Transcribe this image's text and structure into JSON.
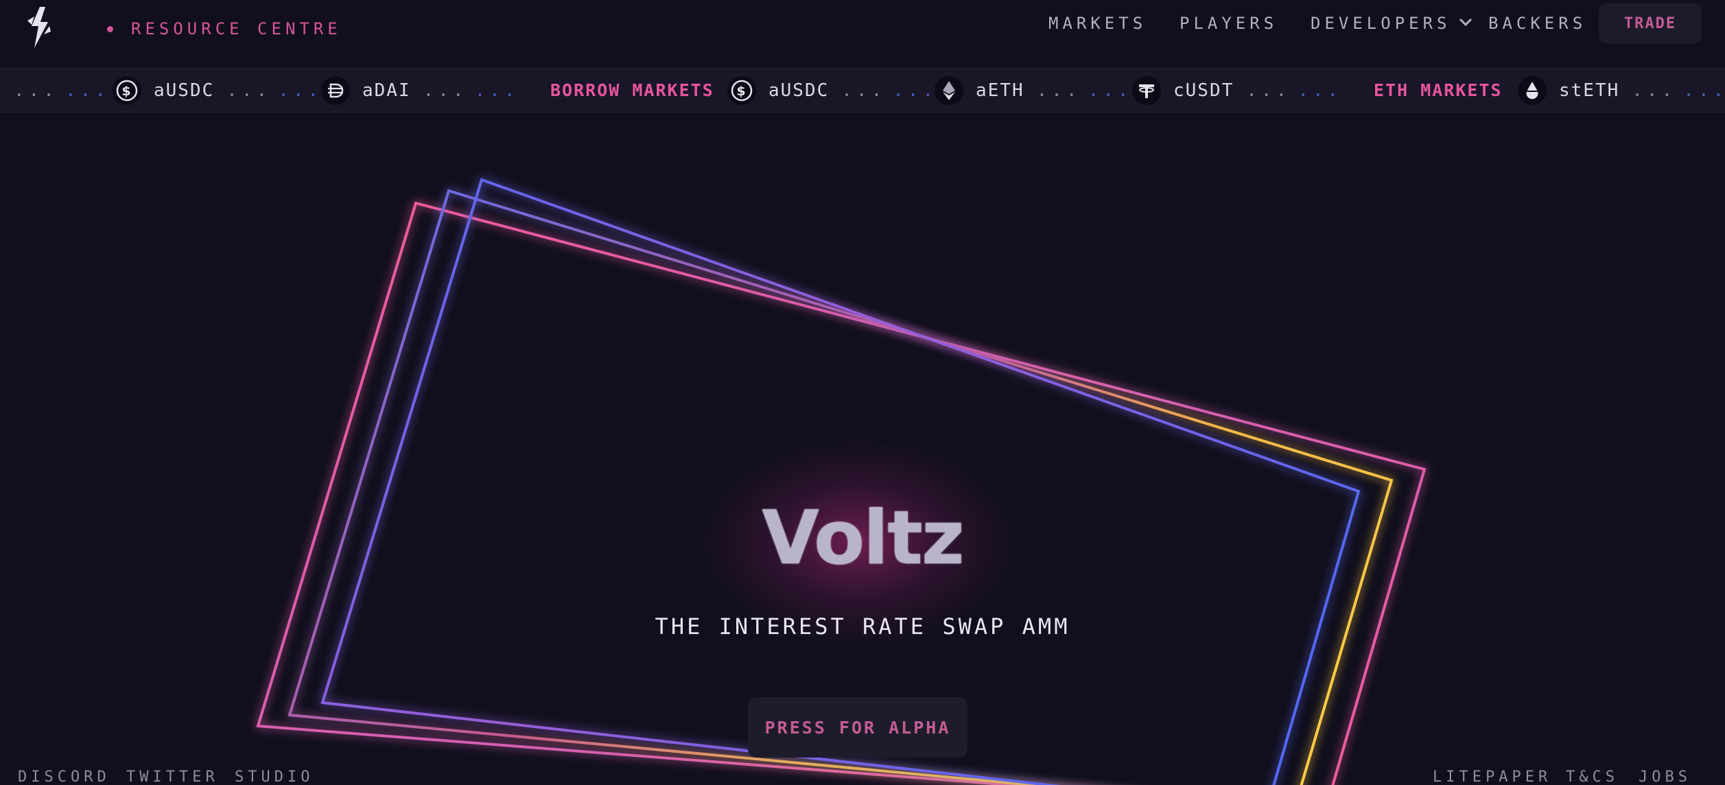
{
  "header": {
    "resource_label": "RESOURCE CENTRE",
    "nav": {
      "markets": "MARKETS",
      "players": "PLAYERS",
      "developers": "DEVELOPERS",
      "backers": "BACKERS"
    },
    "trade_label": "TRADE",
    "logo_icon": "voltz-lightning-logo"
  },
  "ticker": {
    "lead_dots": "...",
    "lead_dots2": "...",
    "items": [
      {
        "icon": "usdc-coin-icon",
        "label": "aUSDC",
        "dots": "...",
        "dots2": "..."
      },
      {
        "icon": "dai-coin-icon",
        "label": "aDAI",
        "dots": "...",
        "dots2": "..."
      },
      {
        "heading": "BORROW MARKETS"
      },
      {
        "icon": "usdc-coin-icon",
        "label": "aUSDC",
        "dots": "...",
        "dots2": "..."
      },
      {
        "icon": "eth-coin-icon",
        "label": "aETH",
        "dots": "...",
        "dots2": "..."
      },
      {
        "icon": "usdt-coin-icon",
        "label": "cUSDT",
        "dots": "...",
        "dots2": "..."
      },
      {
        "heading": "ETH MARKETS"
      },
      {
        "icon": "steth-coin-icon",
        "label": "stETH",
        "dots": "...",
        "dots2": "..."
      }
    ]
  },
  "hero": {
    "title": "Voltz",
    "subtitle": "THE INTEREST RATE SWAP AMM",
    "cta": "PRESS FOR ALPHA"
  },
  "footer": {
    "left": [
      "DISCORD",
      "TWITTER",
      "STUDIO"
    ],
    "right": [
      "LITEPAPER",
      "T&CS",
      "JOBS"
    ]
  },
  "colors": {
    "background": "#110f1d",
    "accent_pink": "#e8559c",
    "ticker_bg": "#181627",
    "button_bg": "#1e1c2b"
  }
}
